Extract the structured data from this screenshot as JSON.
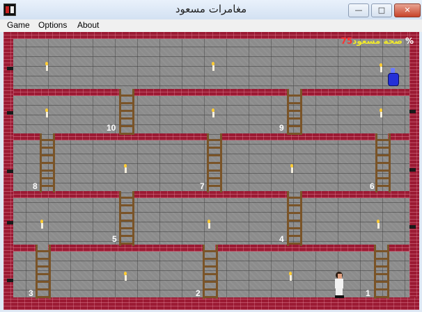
{
  "window": {
    "title": "مغامرات مسعود"
  },
  "menu": [
    "Game",
    "Options",
    "About"
  ],
  "hud": {
    "label": "صحة مسعود",
    "health": "75",
    "unit": "%"
  },
  "ladders": [
    {
      "label": "1"
    },
    {
      "label": "2"
    },
    {
      "label": "3"
    },
    {
      "label": "4"
    },
    {
      "label": "5"
    },
    {
      "label": "6"
    },
    {
      "label": "7"
    },
    {
      "label": "8"
    },
    {
      "label": "9"
    },
    {
      "label": "10"
    }
  ],
  "colors": {
    "brick": "#9b1a33",
    "wall": "#8c8c8c",
    "ladder": "#7a5428",
    "hud_text": "#f2ea2a",
    "hud_value": "#ff3030"
  }
}
